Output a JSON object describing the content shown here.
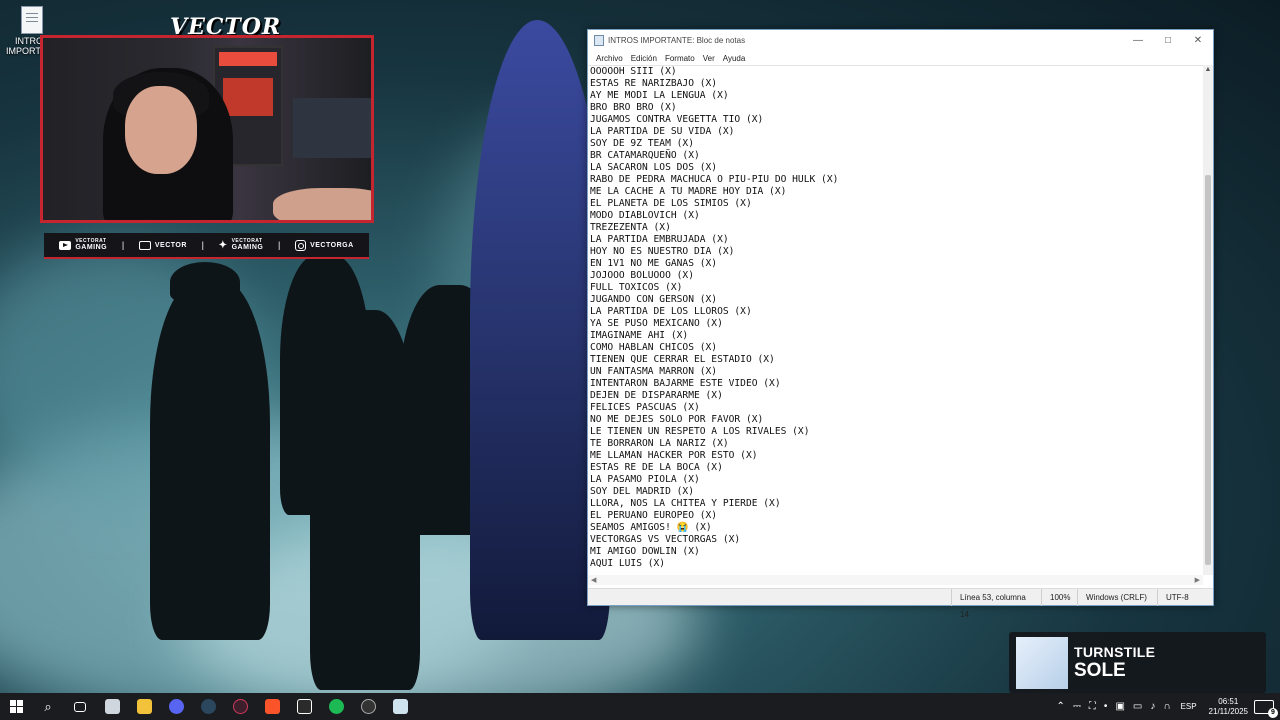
{
  "desktop": {
    "icon_label": "INTROS IMPORTANTE"
  },
  "overlay": {
    "brand": "VECTOR",
    "socials": [
      {
        "icon": "youtube-icon",
        "small": "VECTORAT",
        "label": "GAMING"
      },
      {
        "icon": "twitch-icon",
        "small": "",
        "label": "VECTOR"
      },
      {
        "icon": "twitter-icon",
        "small": "VECTORAT",
        "label": "GAMING"
      },
      {
        "icon": "instagram-icon",
        "small": "",
        "label": "VECTORGA"
      }
    ]
  },
  "notepad": {
    "title": "INTROS IMPORTANTE: Bloc de notas",
    "menu": [
      "Archivo",
      "Edición",
      "Formato",
      "Ver",
      "Ayuda"
    ],
    "lines": [
      "OOOOOH SIII (X)",
      "ESTAS RE NARIZBAJO (X)",
      "AY ME MODI LA LENGUA (X)",
      "BRO BRO BRO (X)",
      "JUGAMOS CONTRA VEGETTA TIO (X)",
      "LA PARTIDA DE SU VIDA (X)",
      "SOY DE 9Z TEAM (X)",
      "BR CATAMARQUEÑO (X)",
      "LA SACARON LOS DOS (X)",
      "RABO DE PEDRA MACHUCA O PIU-PIU DO HULK (X)",
      "ME LA CACHE A TU MADRE HOY DIA (X)",
      "EL PLANETA DE LOS SIMIOS (X)",
      "MODO DIABLOVICH (X)",
      "TREZEZENTA (X)",
      "LA PARTIDA EMBRUJADA (X)",
      "HOY NO ES NUESTRO DIA (X)",
      "EN 1V1 NO ME GANAS (X)",
      "JOJOOO BOLUOOO (X)",
      "FULL TOXICOS (X)",
      "JUGANDO CON GERSON (X)",
      "LA PARTIDA DE LOS LLOROS (X)",
      "YA SE PUSO MEXICANO (X)",
      "IMAGINAME AHI (X)",
      "COMO HABLAN CHICOS (X)",
      "TIENEN QUE CERRAR EL ESTADIO (X)",
      "UN FANTASMA MARRON (X)",
      "INTENTARON BAJARME ESTE VIDEO (X)",
      "DEJEN DE DISPARARME (X)",
      "FELICES PASCUAS (X)",
      "NO ME DEJES SOLO POR FAVOR (X)",
      "LE TIENEN UN RESPETO A LOS RIVALES (X)",
      "TE BORRARON LA NARIZ (X)",
      "ME LLAMAN HACKER POR ESTO (X)",
      "ESTAS RE DE LA BOCA (X)",
      "LA PASAMO PIOLA (X)",
      "SOY DEL MADRID (X)",
      "LLORA, NOS LA CHITEA Y PIERDE (X)",
      "EL PERUANO EUROPEO (X)",
      "SEAMOS AMIGOS! 😭 (X)",
      "VECTORGAS VS VECTORGAS (X)",
      "MI AMIGO DOWLIN (X)",
      "AQUI LUIS (X)"
    ],
    "status": {
      "position": "Línea 53, columna 14",
      "zoom": "100%",
      "line_ending": "Windows (CRLF)",
      "encoding": "UTF-8"
    }
  },
  "now_playing": {
    "artist": "TURNSTILE",
    "song": "SOLE"
  },
  "taskbar": {
    "apps": [
      "start-icon",
      "search-icon",
      "task-view-icon",
      "file-manager-icon",
      "folder-icon",
      "discord-icon",
      "steam-icon",
      "obs-icon",
      "brave-icon",
      "epic-games-icon",
      "spotify-icon",
      "ubisoft-icon",
      "notepad-icon"
    ],
    "language": "ESP",
    "time": "06:51",
    "date": "21/11/2025",
    "notification_count": "9"
  }
}
